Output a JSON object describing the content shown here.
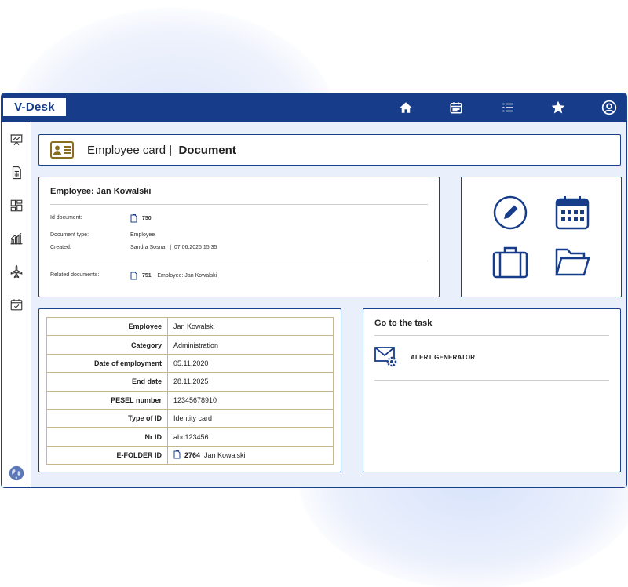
{
  "app": {
    "logo": "V-Desk"
  },
  "topbar": {
    "icons": [
      "home-icon",
      "calendar-icon",
      "list-icon",
      "star-icon",
      "user-circle-icon"
    ]
  },
  "sidebar": {
    "icons": [
      "presentation-chart-icon",
      "document-table-icon",
      "dashboard-icon",
      "bar-chart-icon",
      "plane-icon",
      "calendar-check-icon",
      "globe-icon"
    ]
  },
  "header": {
    "title": "Employee card |",
    "subtitle": "Document"
  },
  "info": {
    "title": "Employee: Jan Kowalski",
    "fields": {
      "id_label": "Id document:",
      "id_value": "750",
      "type_label": "Document type:",
      "type_value": "Employee",
      "created_label": "Created:",
      "created_value": "Sandra Sosna   |  07.06.2025 15:35",
      "related_label": "Related documents:",
      "related_id": "751",
      "related_text": "|  Employee: Jan Kowalski"
    }
  },
  "actions": {
    "icons": [
      "edit-pencil-icon",
      "calendar-grid-icon",
      "briefcase-icon",
      "folder-open-icon"
    ]
  },
  "details": {
    "rows": [
      {
        "k": "Employee",
        "v": "Jan Kowalski"
      },
      {
        "k": "Category",
        "v": "Administration"
      },
      {
        "k": "Date of employment",
        "v": "05.11.2020"
      },
      {
        "k": "End date",
        "v": "28.11.2025"
      },
      {
        "k": "PESEL number",
        "v": "12345678910"
      },
      {
        "k": "Type of ID",
        "v": "Identity card"
      },
      {
        "k": "Nr ID",
        "v": "abc123456"
      },
      {
        "k": "E-FOLDER ID",
        "v_id": "2764",
        "v": "Jan Kowalski"
      }
    ]
  },
  "task": {
    "title": "Go to the task",
    "item_label": "ALERT GENERATOR"
  },
  "colors": {
    "brand": "#173d8a",
    "accent_gold": "#8a6d1e",
    "table_border": "#c8b68c"
  }
}
